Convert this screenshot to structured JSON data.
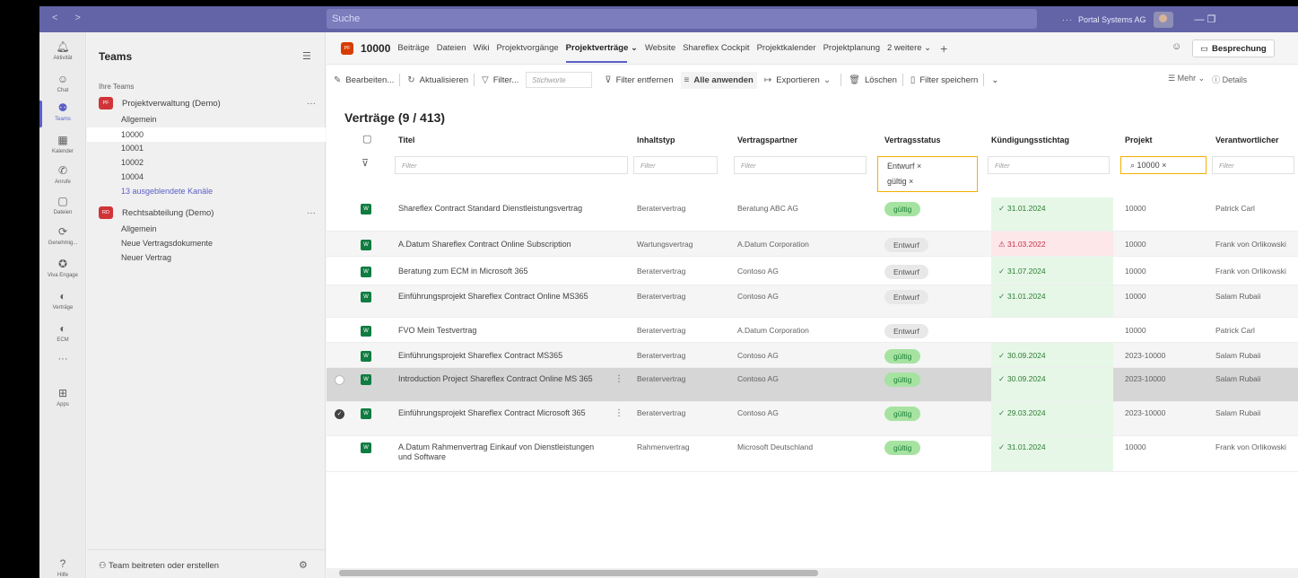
{
  "window": {
    "nav_arrows": "< >",
    "search_placeholder": "Suche",
    "org": "Portal Systems AG",
    "more": "···",
    "window_controls": "—   ❐"
  },
  "rail": [
    {
      "label": "Aktivität",
      "icon": "bell-icon"
    },
    {
      "label": "Chat",
      "icon": "chat-icon"
    },
    {
      "label": "Teams",
      "icon": "teams-icon",
      "active": true
    },
    {
      "label": "Kalender",
      "icon": "calendar-icon"
    },
    {
      "label": "Anrufe",
      "icon": "phone-icon"
    },
    {
      "label": "Dateien",
      "icon": "file-icon"
    },
    {
      "label": "Genehmig...",
      "icon": "approvals-icon"
    },
    {
      "label": "Viva Engage",
      "icon": "viva-icon"
    },
    {
      "label": "Verträge",
      "icon": "shareflex-icon"
    },
    {
      "label": "ECM",
      "icon": "shareflex-icon"
    },
    {
      "label": "···",
      "icon": "more-icon"
    },
    {
      "label": "Apps",
      "icon": "apps-icon"
    },
    {
      "label": "Hilfe",
      "icon": "help-icon"
    }
  ],
  "left": {
    "title": "Teams",
    "your_teams": "Ihre Teams",
    "teams": [
      {
        "badge": "PF",
        "name": "Projektverwaltung (Demo)",
        "channels": [
          "Allgemein",
          "10000",
          "10001",
          "10002",
          "10004"
        ],
        "hidden": "13 ausgeblendete Kanäle"
      },
      {
        "badge": "RD",
        "name": "Rechtsabteilung (Demo)",
        "channels": [
          "Allgemein",
          "Neue Vertragsdokumente",
          "Neuer Vertrag"
        ]
      }
    ],
    "join": "Team beitreten oder erstellen",
    "more": "···"
  },
  "tabs": {
    "badge": "PF",
    "name": "10000",
    "items": [
      "Beiträge",
      "Dateien",
      "Wiki",
      "Projektvorgänge",
      "Projektverträge ⌄",
      "Website",
      "Shareflex Cockpit",
      "Projektkalender",
      "Projektplanung",
      "2 weitere ⌄"
    ],
    "active_index": 4,
    "meeting": "Besprechung"
  },
  "toolbar": {
    "edit": "Bearbeiten...",
    "refresh": "Aktualisieren",
    "filter": "Filter...",
    "keyword_placeholder": "Stichworte",
    "remove_filter": "Filter entfernen",
    "apply_all": "Alle anwenden",
    "export": "Exportieren",
    "delete": "Löschen",
    "save_filter": "Filter speichern",
    "more": "Mehr",
    "details": "Details"
  },
  "list": {
    "title": "Verträge (9 / 413)",
    "columns": [
      "Titel",
      "Inhaltstyp",
      "Vertragspartner",
      "Vertragsstatus",
      "Kündigungsstichtag",
      "Projekt",
      "Verantwortlicher"
    ],
    "filter_placeholder": "Filter",
    "status_filter": [
      "Entwurf ×",
      "gültig ×"
    ],
    "project_filter": "10000 ×",
    "rows": [
      {
        "title": "Shareflex Contract Standard Dienstleistungsvertrag",
        "type": "Beratervertrag",
        "partner": "Beratung ABC AG",
        "status": "gültig",
        "date": "31.01.2024",
        "date_state": "ok",
        "project": "10000",
        "owner": "Patrick Carl"
      },
      {
        "title": "A.Datum Shareflex Contract Online Subscription",
        "type": "Wartungsvertrag",
        "partner": "A.Datum Corporation",
        "status": "Entwurf",
        "date": "31.03.2022",
        "date_state": "bad",
        "project": "10000",
        "owner": "Frank von Orlikowski"
      },
      {
        "title": "Beratung zum ECM in Microsoft 365",
        "type": "Beratervertrag",
        "partner": "Contoso AG",
        "status": "Entwurf",
        "date": "31.07.2024",
        "date_state": "ok",
        "project": "10000",
        "owner": "Frank von Orlikowski"
      },
      {
        "title": "Einführungsprojekt Shareflex Contract Online MS365",
        "type": "Beratervertrag",
        "partner": "Contoso AG",
        "status": "Entwurf",
        "date": "31.01.2024",
        "date_state": "ok",
        "project": "10000",
        "owner": "Salam Rubaii"
      },
      {
        "title": "FVO Mein Testvertrag",
        "type": "Beratervertrag",
        "partner": "A.Datum Corporation",
        "status": "Entwurf",
        "date": "",
        "date_state": "none",
        "project": "10000",
        "owner": "Patrick Carl"
      },
      {
        "title": "Einführungsprojekt Shareflex Contract MS365",
        "type": "Beratervertrag",
        "partner": "Contoso AG",
        "status": "gültig",
        "date": "30.09.2024",
        "date_state": "ok",
        "project": "2023-10000",
        "owner": "Salam Rubaii"
      },
      {
        "title": "Introduction Project Shareflex Contract Online MS 365",
        "type": "Beratervertrag",
        "partner": "Contoso AG",
        "status": "gültig",
        "date": "30.09.2024",
        "date_state": "ok",
        "project": "2023-10000",
        "owner": "Salam Rubaii"
      },
      {
        "title": "Einführungsprojekt Shareflex Contract Microsoft 365",
        "type": "Beratervertrag",
        "partner": "Contoso AG",
        "status": "gültig",
        "date": "29.03.2024",
        "date_state": "ok",
        "project": "2023-10000",
        "owner": "Salam Rubaii"
      },
      {
        "title": "A.Datum Rahmenvertrag Einkauf von Dienstleistungen und Software",
        "type": "Rahmenvertrag",
        "partner": "Microsoft Deutschland",
        "status": "gültig",
        "date": "31.01.2024",
        "date_state": "ok",
        "project": "10000",
        "owner": "Frank von Orlikowski"
      }
    ]
  },
  "colors": {
    "brand": "#6264a7",
    "accent": "#5b5fc7",
    "filter_border": "#f2b100",
    "ok_bg": "#e6f7e8",
    "bad_bg": "#fde7e9"
  }
}
